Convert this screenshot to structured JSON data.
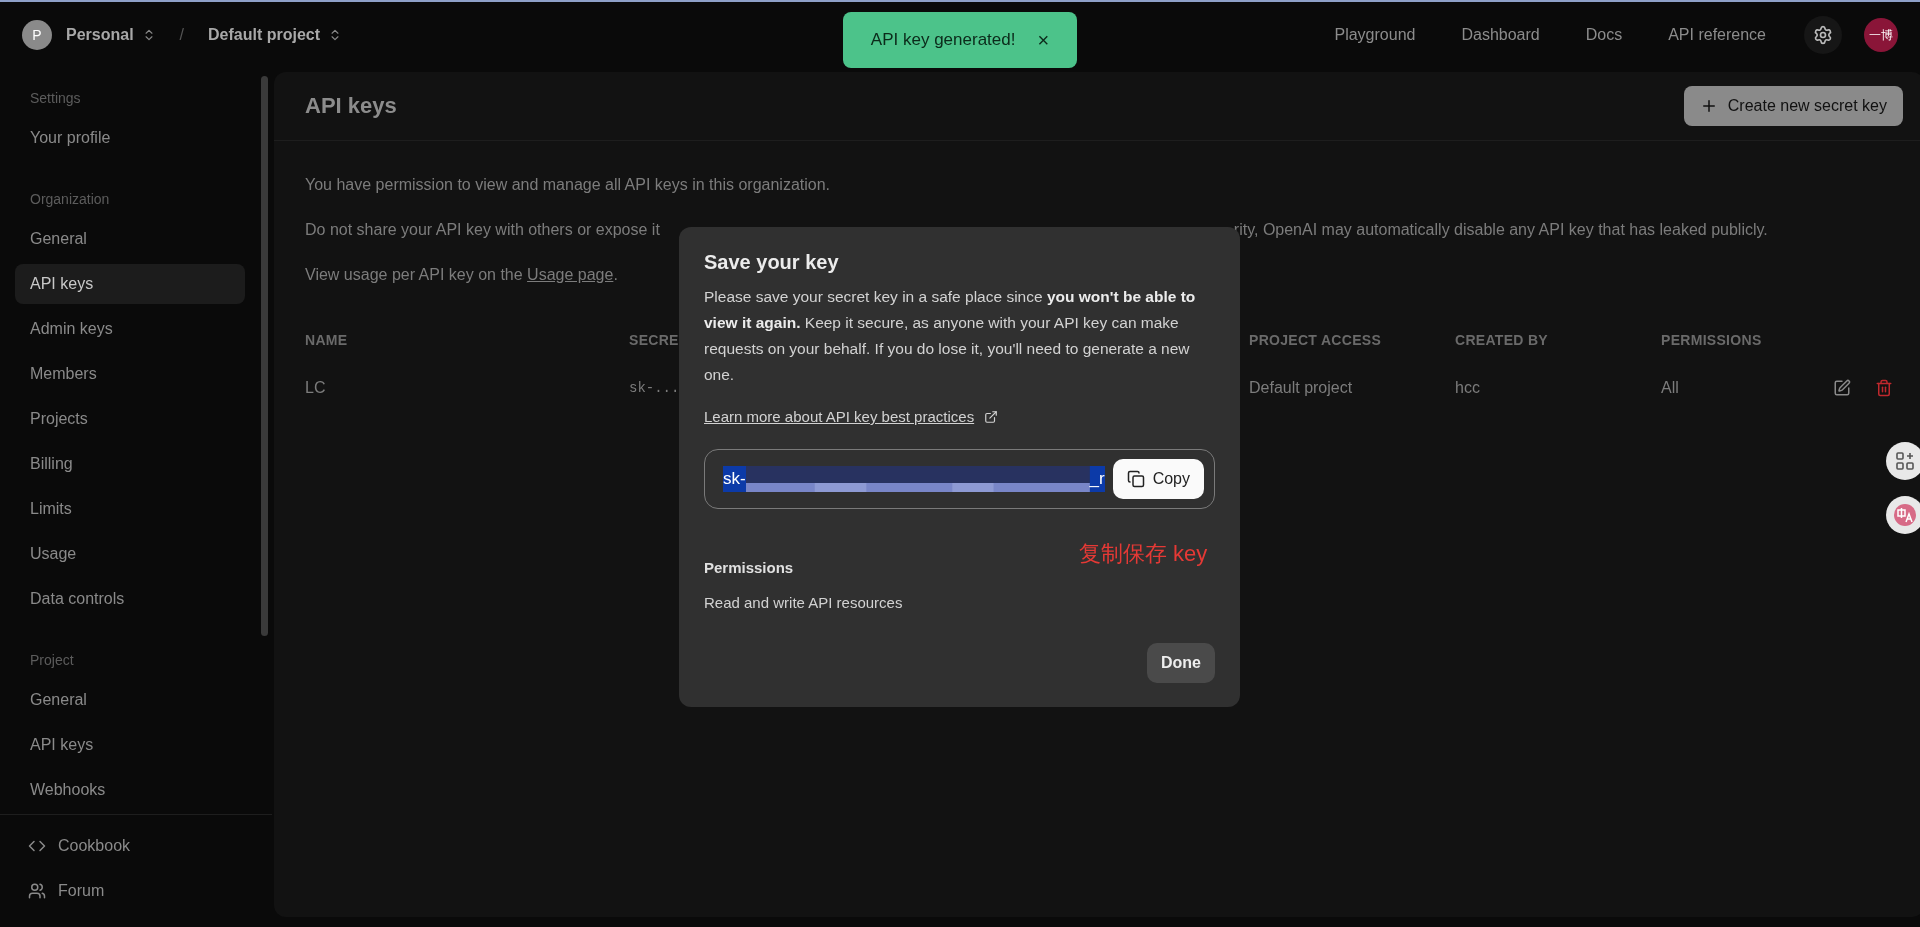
{
  "topbar": {
    "org": {
      "avatar": "P",
      "name": "Personal"
    },
    "separator": "/",
    "project": "Default project",
    "links": [
      "Playground",
      "Dashboard",
      "Docs",
      "API reference"
    ],
    "user_avatar": "一博"
  },
  "toast": {
    "message": "API key generated!",
    "close": "×"
  },
  "sidebar": {
    "sections": [
      {
        "label": "Settings",
        "items": [
          {
            "label": "Your profile",
            "selected": false
          }
        ]
      },
      {
        "label": "Organization",
        "items": [
          {
            "label": "General",
            "selected": false
          },
          {
            "label": "API keys",
            "selected": true
          },
          {
            "label": "Admin keys",
            "selected": false
          },
          {
            "label": "Members",
            "selected": false
          },
          {
            "label": "Projects",
            "selected": false
          },
          {
            "label": "Billing",
            "selected": false
          },
          {
            "label": "Limits",
            "selected": false
          },
          {
            "label": "Usage",
            "selected": false
          },
          {
            "label": "Data controls",
            "selected": false
          }
        ]
      },
      {
        "label": "Project",
        "items": [
          {
            "label": "General",
            "selected": false
          },
          {
            "label": "API keys",
            "selected": false
          },
          {
            "label": "Webhooks",
            "selected": false
          }
        ]
      }
    ],
    "footer": [
      {
        "kind": "code",
        "label": "Cookbook"
      },
      {
        "kind": "people",
        "label": "Forum"
      }
    ]
  },
  "panel": {
    "title": "API keys",
    "create_button": "Create new secret key",
    "intro": "You have permission to view and manage all API keys in this organization.",
    "warning_left": "Do not share your API key with others or expose it",
    "warning_right": "rity, OpenAI may automatically disable any API key that has leaked publicly.",
    "usage_text": "View usage per API key on the ",
    "usage_link": "Usage page",
    "usage_end": ".",
    "table": {
      "columns": [
        "NAME",
        "SECRE",
        "PROJECT ACCESS",
        "CREATED BY",
        "PERMISSIONS"
      ],
      "rows": [
        {
          "cells": [
            "LC",
            "sk-...",
            "Default project",
            "hcc",
            "All"
          ]
        }
      ]
    }
  },
  "modal": {
    "title": "Save your key",
    "body": "Please save your secret key in a safe place since **you won't be able to view it again.** Keep it secure, as anyone with your API key can make requests on your behalf. If you do lose it, you'll need to generate a new one.",
    "link": "Learn more about API key best practices",
    "key": {
      "prefix": "sk-",
      "suffix": "_r",
      "selected": true
    },
    "copy_button": "Copy",
    "annotation": "复制保存 key",
    "permissions_label": "Permissions",
    "permissions_value": "Read and write API resources",
    "done_button": "Done"
  }
}
